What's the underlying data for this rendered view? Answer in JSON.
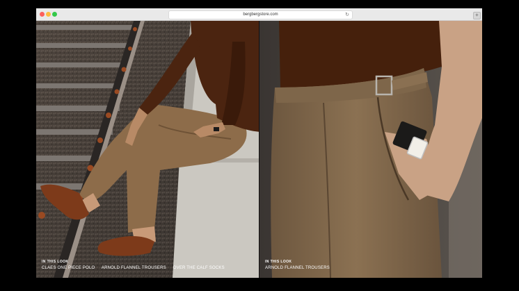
{
  "browser": {
    "url": "bergbergstore.com"
  },
  "looks": [
    {
      "heading": "IN THIS LOOK",
      "products": [
        "CLAES ONE PIECE POLO",
        "ARNOLD FLANNEL TROUSERS",
        "OVER THE CALF SOCKS"
      ]
    },
    {
      "heading": "IN THIS LOOK",
      "products": [
        "ARNOLD FLANNEL TROUSERS"
      ]
    }
  ],
  "colors": {
    "polo": "#4a2410",
    "trousers": "#8a6a48",
    "shoes": "#7a3818",
    "concrete": "#c9c6bf",
    "gravel": "#4a4540"
  },
  "icons": {
    "reload": "reload-icon",
    "new_tab": "new-tab-icon"
  }
}
